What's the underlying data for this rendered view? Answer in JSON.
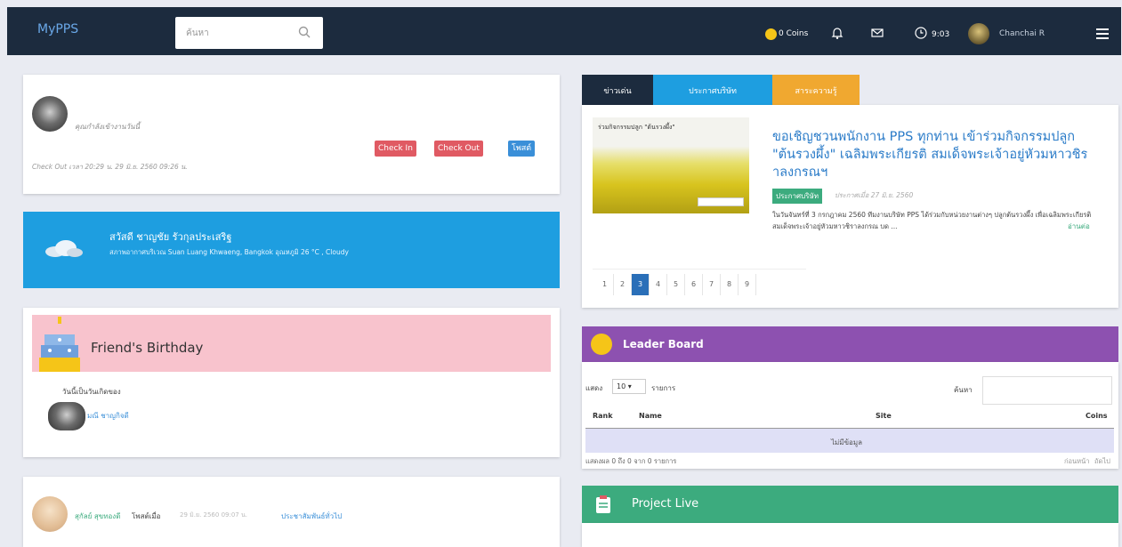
{
  "header": {
    "brand": "MyPPS",
    "search_placeholder": "ค้นหา",
    "coins": "0 Coins",
    "time": "9:03",
    "user": "Chanchai R"
  },
  "checkin": {
    "name": "คุณกำลังเข้างานวันนี้",
    "buttons": [
      "Check In",
      "Check Out",
      "โพสต์"
    ],
    "status": "Check Out เวลา 20:29 น. 29 มิ.ย. 2560 09:26 น."
  },
  "weather": {
    "greeting": "สวัสดี ชาญชัย รัวกุลประเสริฐ",
    "detail": "สภาพอากาศบริเวณ Suan Luang Khwaeng, Bangkok อุณหภูมิ 26 °C , Cloudy"
  },
  "birthday": {
    "title": "Friend's Birthday",
    "subtitle": "วันนี้เป็นวันเกิดของ",
    "person": "มณี ชาญกิจดี"
  },
  "post": {
    "author": "สุกัลย์ สุขทองดี",
    "action": "โพสต์เมื่อ",
    "time": "29 มิ.ย. 2560 09:07 น.",
    "target": "ประชาสัมพันธ์ทั่วไป"
  },
  "news": {
    "tabs": [
      "ข่าวเด่น",
      "ประกาศบริษัท",
      "สาระความรู้"
    ],
    "thumb_title": "ร่วมกิจกรรมปลูก \"ต้นรวงผึ้ง\"",
    "headline": "ขอเชิญชวนพนักงาน PPS ทุกท่าน เข้าร่วมกิจกรรมปลูก \"ต้นรวงผึ้ง\" เฉลิมพระเกียรติ สมเด็จพระเจ้าอยู่หัวมหาวชิราลงกรณฯ",
    "badge": "ประกาศบริษัท",
    "date": "ประกาศเมื่อ 27 มิ.ย. 2560",
    "excerpt": "ในวันจันทร์ที่ 3 กรกฎาคม 2560 ทีมงานบริษัท PPS ได้ร่วมกับหน่วยงานต่างๆ ปลูกต้นรวงผึ้ง เพื่อเฉลิมพระเกียรติสมเด็จพระเจ้าอยู่หัวมหาวชิราลงกรณ บด ...",
    "read_more": "อ่านต่อ",
    "pages": [
      "1",
      "2",
      "3",
      "4",
      "5",
      "6",
      "7",
      "8",
      "9"
    ],
    "active_page": "3"
  },
  "leaderboard": {
    "title": "Leader Board",
    "show_label": "แสดง",
    "page_size": "10",
    "rows_label": "รายการ",
    "search_label": "ค้นหา",
    "columns": [
      "Rank",
      "Name",
      "Site",
      "Coins"
    ],
    "empty": "ไม่มีข้อมูล",
    "footer": "แสดงผล 0 ถึง 0 จาก 0 รายการ",
    "prev": "ก่อนหน้า",
    "next": "ถัดไป"
  },
  "project": {
    "title": "Project Live"
  },
  "colors": {
    "topbar": "#1c2b3e",
    "weather": "#1e9ee0",
    "birthday": "#f8c3cd",
    "tab_news": "#1c2b3e",
    "tab_company": "#1e9ee0",
    "tab_knowledge": "#f0a830",
    "leaderboard": "#8d51b0",
    "project": "#3cab7e",
    "checkin": "#e05a63",
    "post": "#3a8fd8"
  }
}
